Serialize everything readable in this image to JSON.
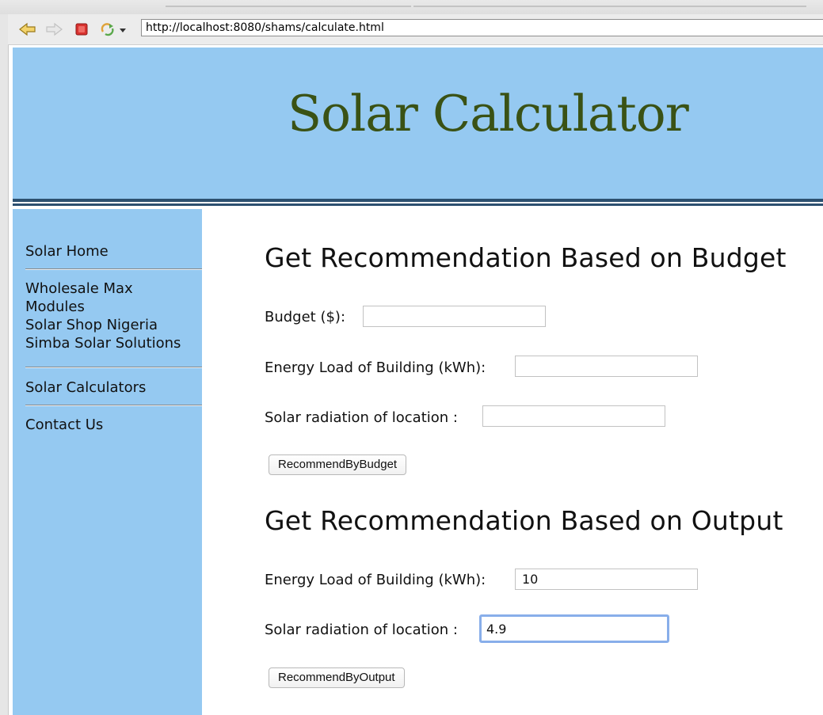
{
  "browser": {
    "url": "http://localhost:8080/shams/calculate.html"
  },
  "header": {
    "title": "Solar Calculator"
  },
  "sidebar": {
    "items": [
      {
        "label": "Solar Home"
      },
      {
        "label": "Wholesale Max"
      },
      {
        "label": "Modules"
      },
      {
        "label": "Solar Shop Nigeria"
      },
      {
        "label": "Simba Solar Solutions"
      },
      {
        "label": "Solar Calculators"
      },
      {
        "label": "Contact Us"
      }
    ]
  },
  "budget_section": {
    "heading": "Get Recommendation Based on Budget",
    "budget_label": "Budget ($):",
    "budget_value": "",
    "energy_label": "Energy Load of Building (kWh):",
    "energy_value": "",
    "radiation_label": "Solar radiation of location :",
    "radiation_value": "",
    "button_label": "RecommendByBudget"
  },
  "output_section": {
    "heading": "Get Recommendation Based on Output",
    "energy_label": "Energy Load of Building (kWh):",
    "energy_value": "10",
    "radiation_label": "Solar radiation of location :",
    "radiation_value": "4.9",
    "button_label": "RecommendByOutput"
  },
  "colors": {
    "header_bg": "#95c9f1",
    "title_text": "#3a5215",
    "rule": "#2d5070",
    "focus_ring": "#88aeea"
  },
  "icons": [
    "back-icon",
    "forward-icon",
    "stop-icon",
    "reload-icon",
    "dropdown-arrow-icon"
  ]
}
